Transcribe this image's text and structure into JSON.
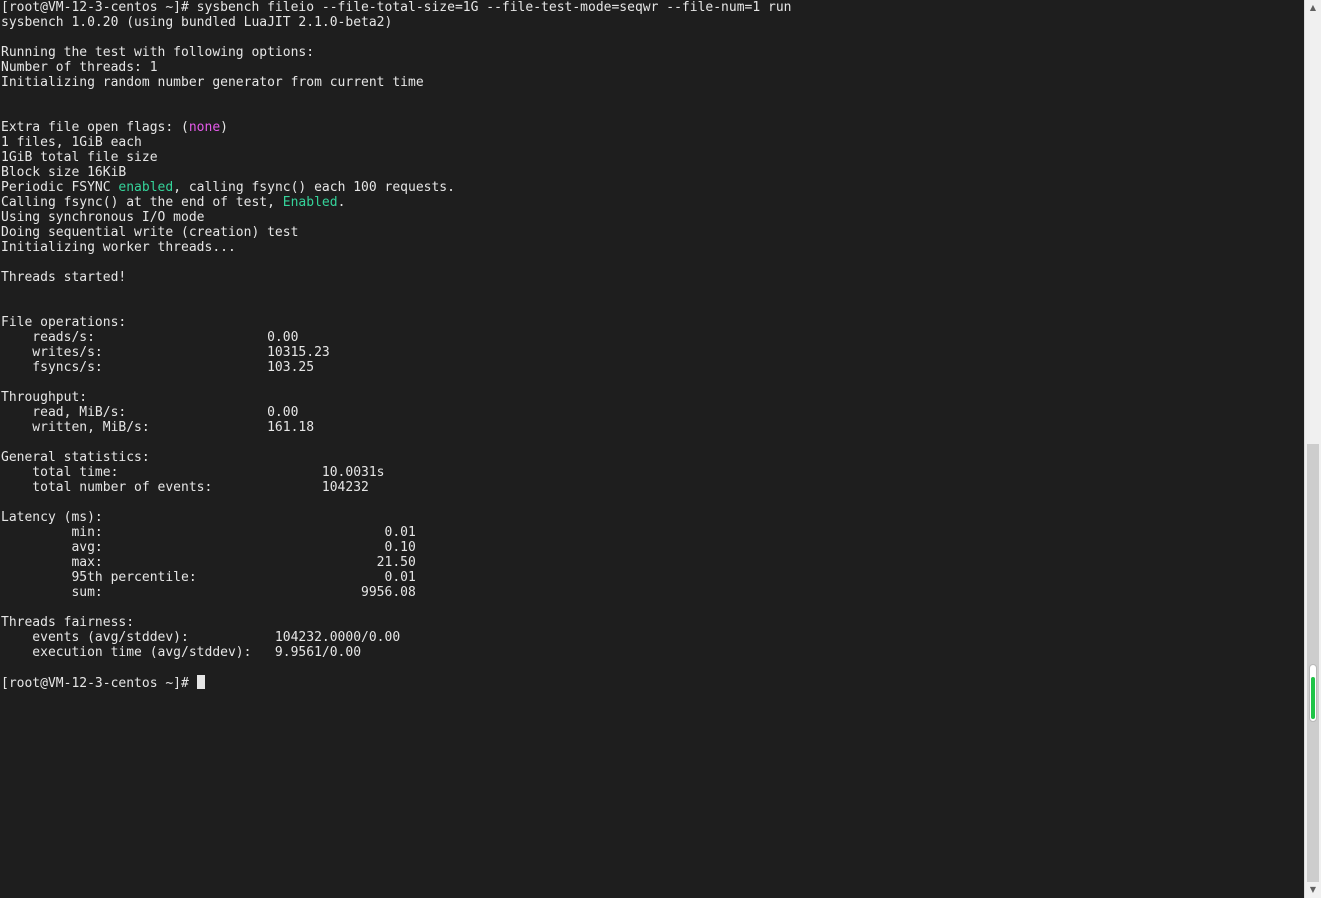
{
  "terminal": {
    "lines": [
      "[root@VM-12-3-centos ~]# sysbench fileio --file-total-size=1G --file-test-mode=seqwr --file-num=1 run",
      "sysbench 1.0.20 (using bundled LuaJIT 2.1.0-beta2)",
      "",
      "Running the test with following options:",
      "Number of threads: 1",
      "Initializing random number generator from current time",
      "",
      "",
      "Extra file open flags: (none)",
      "1 files, 1GiB each",
      "1GiB total file size",
      "Block size 16KiB",
      "Periodic FSYNC enabled, calling fsync() each 100 requests.",
      "Calling fsync() at the end of test, Enabled.",
      "Using synchronous I/O mode",
      "Doing sequential write (creation) test",
      "Initializing worker threads...",
      "",
      "Threads started!",
      "",
      "",
      "File operations:",
      "    reads/s:                      0.00",
      "    writes/s:                     10315.23",
      "    fsyncs/s:                     103.25",
      "",
      "Throughput:",
      "    read, MiB/s:                  0.00",
      "    written, MiB/s:               161.18",
      "",
      "General statistics:",
      "    total time:                          10.0031s",
      "    total number of events:              104232",
      "",
      "Latency (ms):",
      "         min:                                    0.01",
      "         avg:                                    0.10",
      "         max:                                   21.50",
      "         95th percentile:                        0.01",
      "         sum:                                 9956.08",
      "",
      "Threads fairness:",
      "    events (avg/stddev):           104232.0000/0.00",
      "    execution time (avg/stddev):   9.9561/0.00",
      "",
      "[root@VM-12-3-centos ~]# "
    ],
    "highlights": [
      {
        "line": 8,
        "text": "none",
        "color": "#e45ae9"
      },
      {
        "line": 12,
        "text": "enabled",
        "color": "#35d39a"
      },
      {
        "line": 13,
        "text": "Enabled",
        "color": "#35d39a"
      }
    ],
    "text_color": "#e6e6e6",
    "background_color": "#1e1e1e",
    "cursor_line": 45
  },
  "scrollbar": {
    "up_arrow_icon": "▲",
    "down_arrow_icon": "▼",
    "marker_color": "#1fc447"
  }
}
